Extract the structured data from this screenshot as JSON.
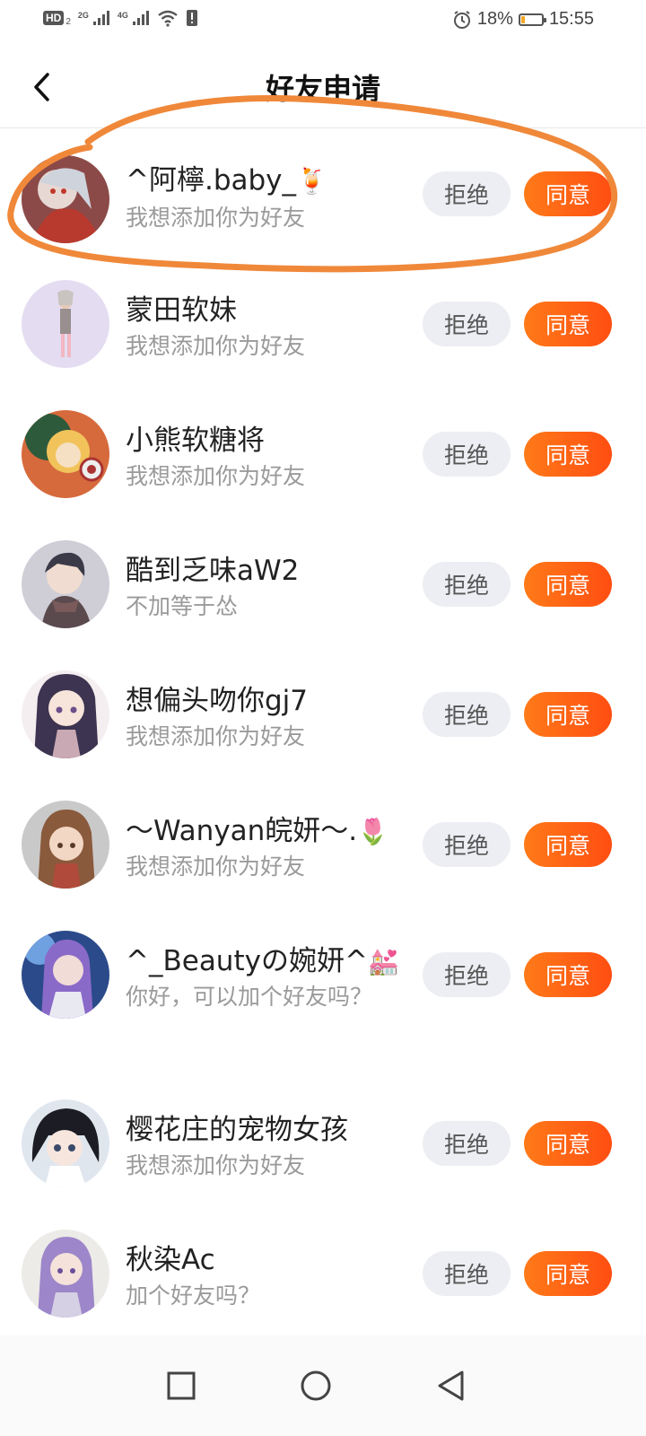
{
  "status_bar": {
    "hd": "HD",
    "hd_sub": "2",
    "net1": "2G",
    "net2": "4G",
    "battery_percent": "18%",
    "battery_level": 0.18,
    "time": "15:55"
  },
  "header": {
    "title": "好友申请"
  },
  "buttons": {
    "reject": "拒绝",
    "accept": "同意"
  },
  "requests": [
    {
      "name": "^阿檸.baby_",
      "emoji": "🍹",
      "message": "我想添加你为好友"
    },
    {
      "name": "蒙田软妹",
      "emoji": "",
      "message": "我想添加你为好友"
    },
    {
      "name": "小熊软糖将",
      "emoji": "",
      "message": "我想添加你为好友"
    },
    {
      "name": "酷到乏味aW2",
      "emoji": "",
      "message": "不加等于怂"
    },
    {
      "name": "想偏头吻你gj7",
      "emoji": "",
      "message": "我想添加你为好友"
    },
    {
      "name": "～Wanyan皖妍～.",
      "emoji": "🌷",
      "message": "我想添加你为好友"
    },
    {
      "name": "^_Beautyの婉妍^",
      "emoji": "💒",
      "message": "你好，可以加个好友吗？"
    },
    {
      "name": "樱花庄的宠物女孩",
      "emoji": "",
      "message": "我想添加你为好友"
    },
    {
      "name": "秋染Ac",
      "emoji": "",
      "message": "加个好友吗？"
    }
  ],
  "colors": {
    "accent": "#ff5a14",
    "annotation": "#f0883a",
    "reject_bg": "#eceef3",
    "secondary_text": "#9a9a9a"
  },
  "icons": {
    "back": "chevron-left-icon",
    "nav_recent": "square-icon",
    "nav_home": "circle-icon",
    "nav_back": "triangle-back-icon"
  }
}
